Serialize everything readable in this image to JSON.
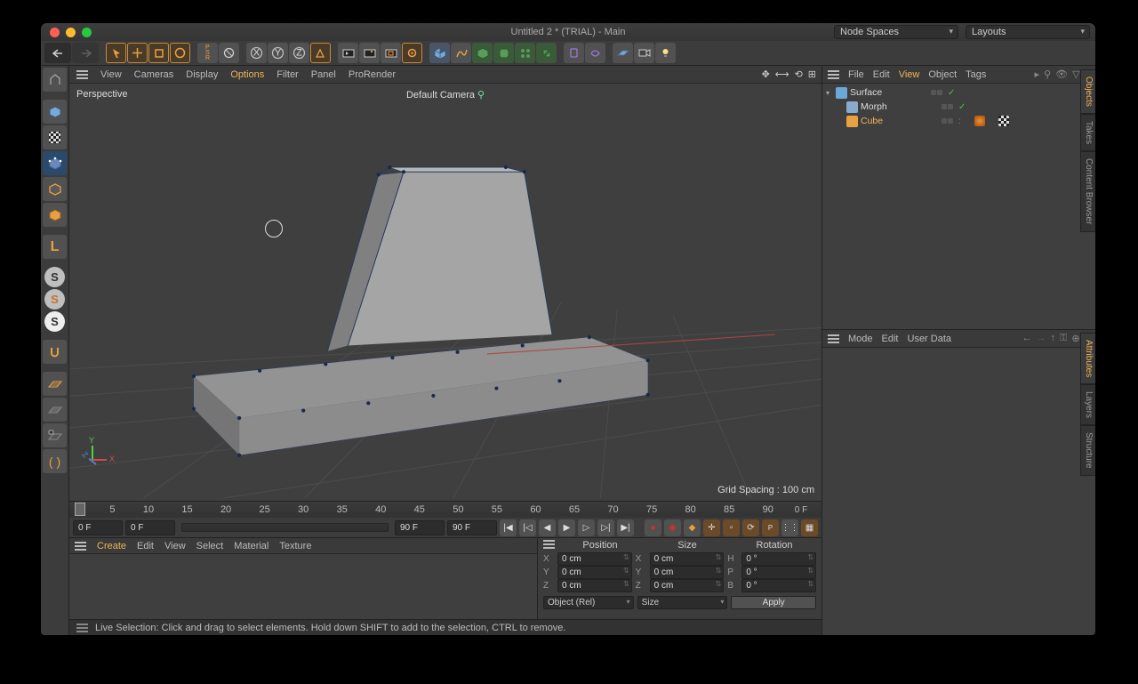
{
  "window": {
    "title": "Untitled 2 * (TRIAL) - Main"
  },
  "dropdowns": {
    "nodespaces": "Node Spaces",
    "layouts": "Layouts"
  },
  "viewport_menu": {
    "items": [
      "View",
      "Cameras",
      "Display",
      "Options",
      "Filter",
      "Panel",
      "ProRender"
    ],
    "active": "Options"
  },
  "viewport": {
    "label_tl": "Perspective",
    "label_top": "Default Camera",
    "grid_spacing": "Grid Spacing : 100 cm"
  },
  "timeline": {
    "ticks": [
      "0",
      "5",
      "10",
      "15",
      "20",
      "25",
      "30",
      "35",
      "40",
      "45",
      "50",
      "55",
      "60",
      "65",
      "70",
      "75",
      "80",
      "85",
      "90"
    ],
    "end_label": "0 F",
    "start_frame": "0 F",
    "in_frame": "0 F",
    "out_frame": "90 F",
    "end_frame": "90 F"
  },
  "material_menu": {
    "items": [
      "Create",
      "Edit",
      "View",
      "Select",
      "Material",
      "Texture"
    ],
    "active": "Create"
  },
  "coord": {
    "headers": {
      "pos": "Position",
      "size": "Size",
      "rot": "Rotation"
    },
    "rows": [
      {
        "axis": "X",
        "p": "0 cm",
        "s": "0 cm",
        "rlab": "H",
        "r": "0 °"
      },
      {
        "axis": "Y",
        "p": "0 cm",
        "s": "0 cm",
        "rlab": "P",
        "r": "0 °"
      },
      {
        "axis": "Z",
        "p": "0 cm",
        "s": "0 cm",
        "rlab": "B",
        "r": "0 °"
      }
    ],
    "mode": "Object (Rel)",
    "size_mode": "Size",
    "apply": "Apply"
  },
  "status": "Live Selection: Click and drag to select elements. Hold down SHIFT to add to the selection, CTRL to remove.",
  "obj_menu": {
    "items": [
      "File",
      "Edit",
      "View",
      "Object",
      "Tags"
    ],
    "active": "View"
  },
  "objects": [
    {
      "name": "Surface",
      "icon": "nurbs",
      "color": "#6aa8d8",
      "sel": false,
      "nested": false,
      "twisty": "▾",
      "tags": []
    },
    {
      "name": "Morph",
      "icon": "morph",
      "color": "#8ac",
      "sel": false,
      "nested": true,
      "twisty": "",
      "tags": []
    },
    {
      "name": "Cube",
      "icon": "cube",
      "color": "#e8a040",
      "sel": true,
      "nested": true,
      "twisty": "",
      "tags": [
        "orange",
        "checker"
      ]
    }
  ],
  "attr_menu": {
    "items": [
      "Mode",
      "Edit",
      "User Data"
    ]
  },
  "side_tabs_top": [
    "Objects",
    "Takes",
    "Content Browser"
  ],
  "side_tabs_bottom": [
    "Attributes",
    "Layers",
    "Structure"
  ]
}
